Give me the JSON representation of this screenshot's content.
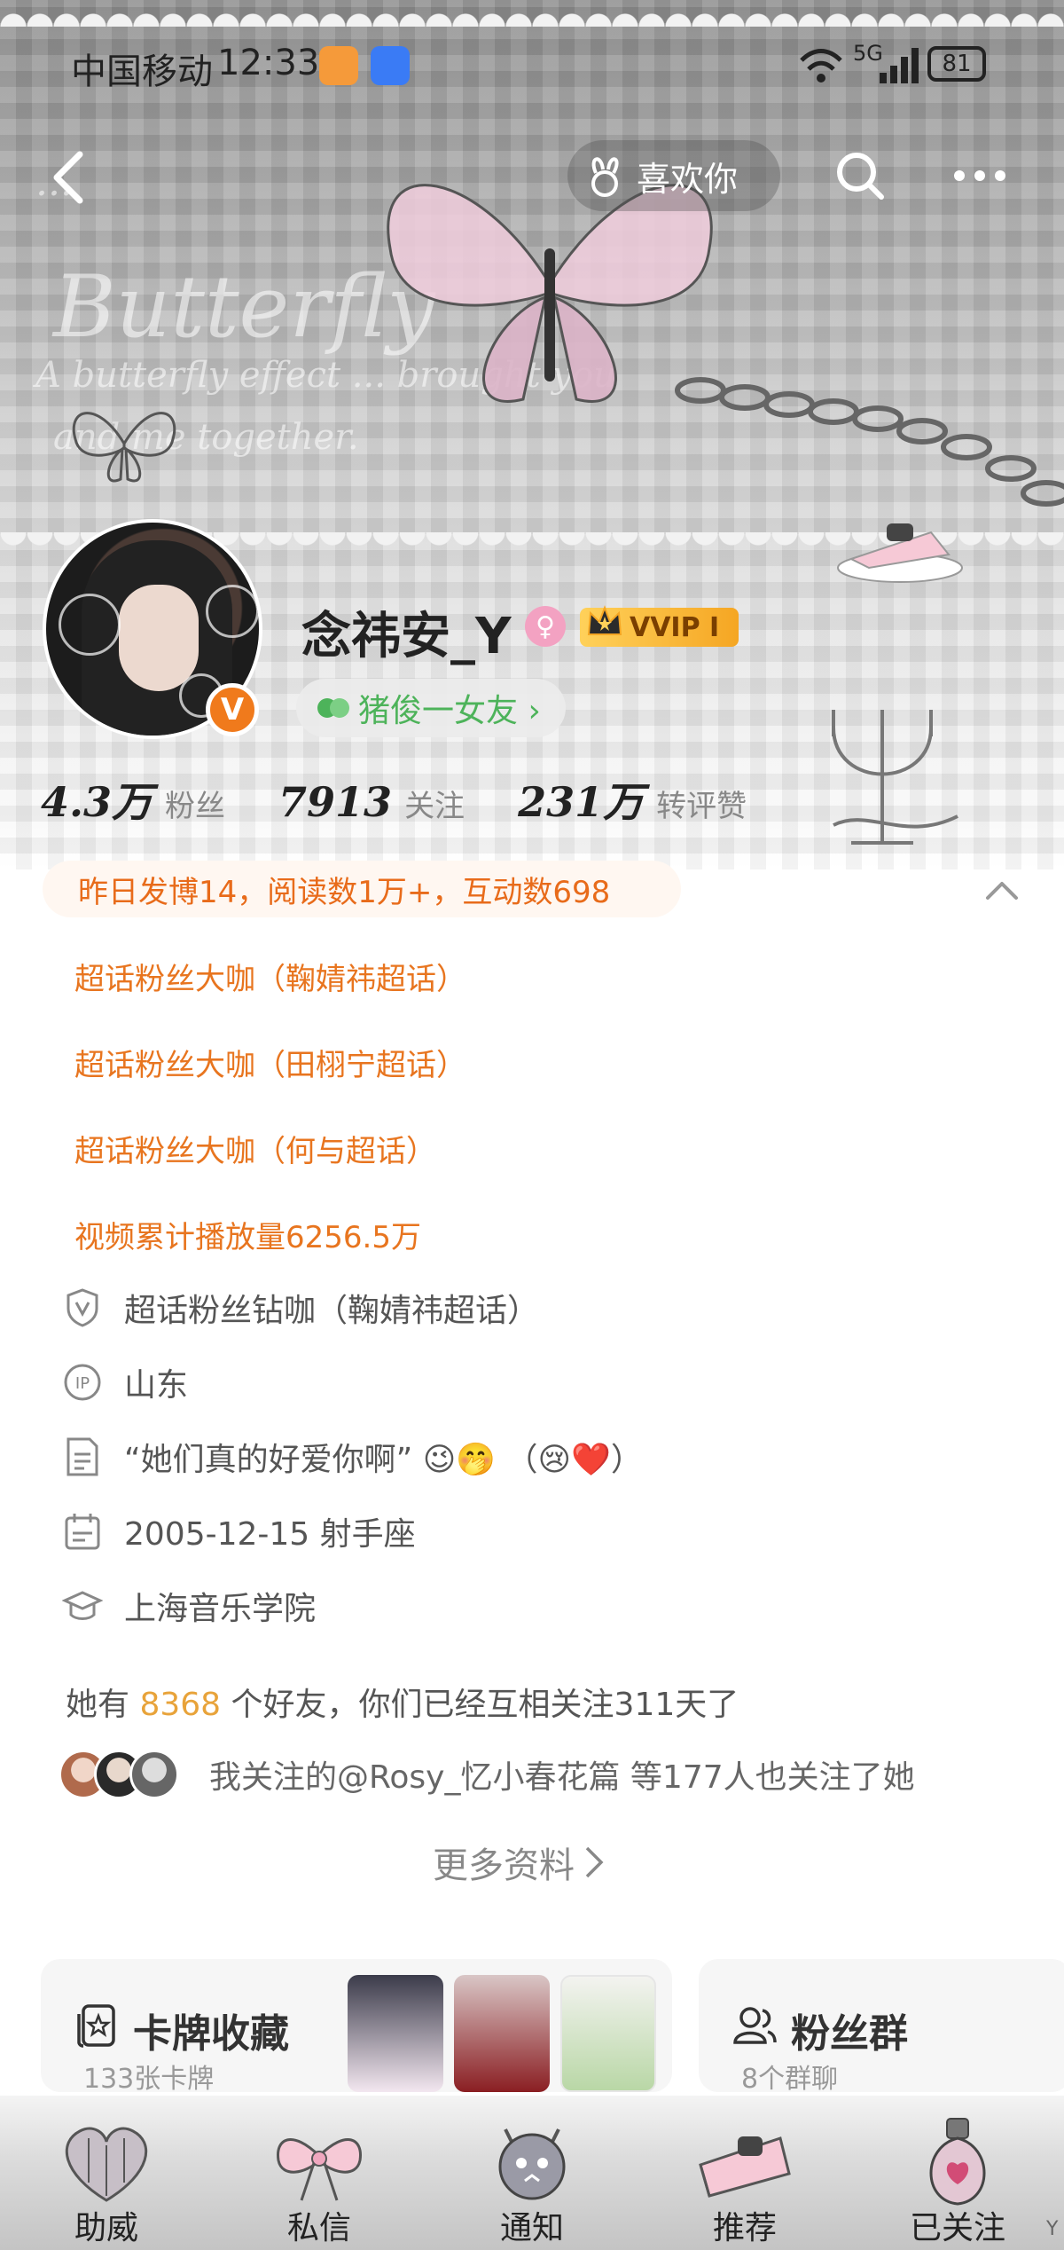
{
  "status_bar": {
    "carrier": "中国移动",
    "time": "12:33",
    "network": "5G",
    "battery": "81"
  },
  "nav": {
    "like_label": "喜欢你"
  },
  "banner_text": {
    "line1": "...",
    "line2": "Butterfly",
    "line3": "A butterfly effect ... brought you",
    "line4": "and me together."
  },
  "profile": {
    "username": "念祎安_Y",
    "vip_label": "VVIP I",
    "group_label": "猪俊一女友 ›",
    "verified_letter": "V"
  },
  "stats": [
    {
      "value": "4.3万",
      "label": "粉丝"
    },
    {
      "value": "7913",
      "label": "关注"
    },
    {
      "value": "231万",
      "label": "转评赞"
    }
  ],
  "summary": "昨日发博14，阅读数1万+，互动数698",
  "achievements": [
    "超话粉丝大咖（鞠婧祎超话）",
    "超话粉丝大咖（田栩宁超话）",
    "超话粉丝大咖（何与超话）",
    "视频累计播放量6256.5万"
  ],
  "info": {
    "badge": "超话粉丝钻咖（鞠婧祎超话）",
    "ip": "山东",
    "bio": "“她们真的好爱你啊” 😉🤭  （😢❤️）",
    "birthday": "2005-12-15 射手座",
    "school": "上海音乐学院"
  },
  "friends": {
    "prefix": "她有",
    "count": "8368",
    "suffix": "个好友，你们已经互相关注311天了"
  },
  "mutual_text": "我关注的@Rosy_忆小春花篇 等177人也关注了她",
  "more_info": "更多资料",
  "cards": {
    "collection": {
      "title": "卡牌收藏",
      "sub": "133张卡牌"
    },
    "fans": {
      "title": "粉丝群",
      "sub": "8个群聊"
    }
  },
  "tabs": [
    "助威",
    "私信",
    "通知",
    "推荐",
    "已关注"
  ],
  "colors": {
    "accent_orange": "#e8751f",
    "highlight": "#e8a33a",
    "green": "#4db35a"
  }
}
